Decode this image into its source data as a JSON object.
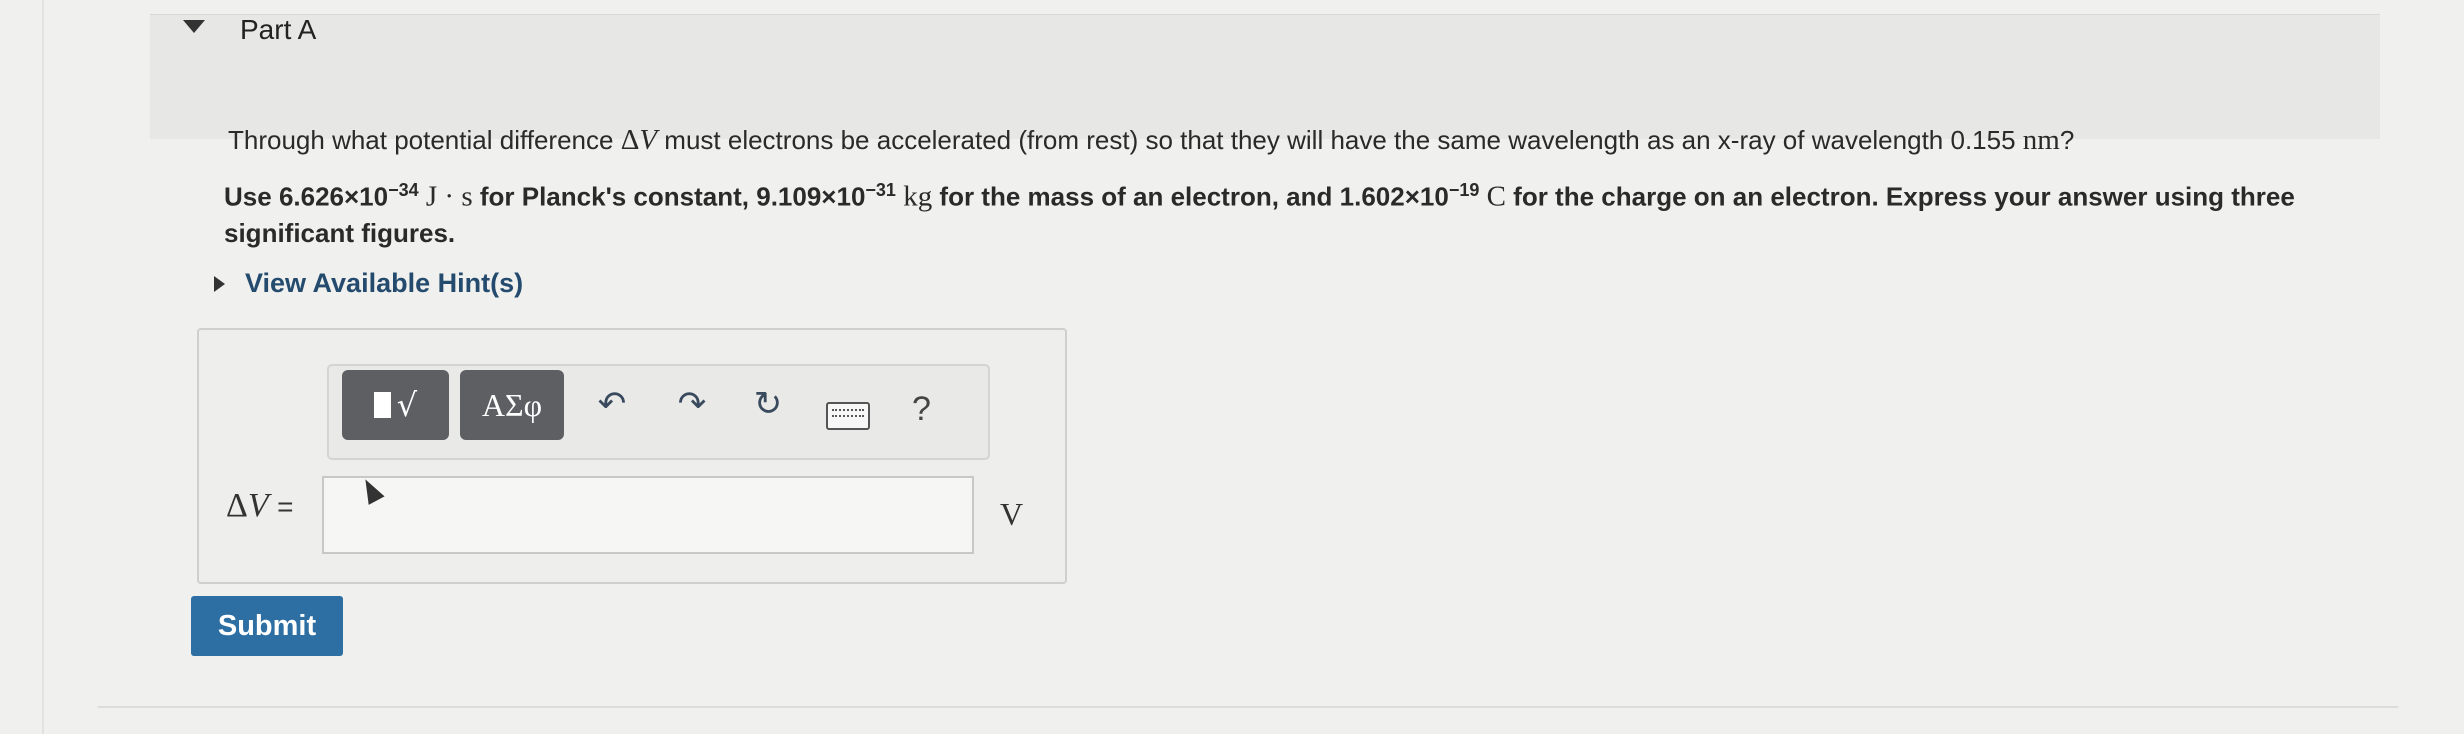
{
  "part": {
    "title": "Part A"
  },
  "question": {
    "prefix": "Through what potential difference",
    "delta_symbol": "Δ",
    "var_symbol": "V",
    "suffix": "must electrons be accelerated (from rest) so that they will have the same wavelength as an x-ray of wavelength",
    "wavelength_value": "0.155",
    "wavelength_unit": "nm",
    "qmark": "?"
  },
  "instructions": {
    "use_label": "Use",
    "planck_mantissa": "6.626×10",
    "planck_exp": "−34",
    "planck_unit": "J · s",
    "planck_desc": "for Planck's constant,",
    "mass_mantissa": "9.109×10",
    "mass_exp": "−31",
    "mass_unit": "kg",
    "mass_desc": "for the mass of an electron, and",
    "charge_mantissa": "1.602×10",
    "charge_exp": "−19",
    "charge_unit": "C",
    "charge_desc": "for the charge on an electron. Express your answer using three significant figures."
  },
  "hint": {
    "label": "View Available Hint(s)"
  },
  "toolbar": {
    "templates_icon": "templates-radical-icon",
    "radical_glyph": "√",
    "greek_label": "ΑΣφ",
    "undo_glyph": "↶",
    "redo_glyph": "↷",
    "reset_glyph": "↻",
    "keyboard_icon": "keyboard-icon",
    "help_label": "?"
  },
  "answer": {
    "label_delta": "Δ",
    "label_var": "V",
    "label_eq": "=",
    "value": "",
    "unit": "V"
  },
  "submit": {
    "label": "Submit"
  },
  "colors": {
    "submit_bg": "#2d6ea3",
    "hint_link": "#244b6e",
    "toolbar_dark": "#5d5f63"
  }
}
